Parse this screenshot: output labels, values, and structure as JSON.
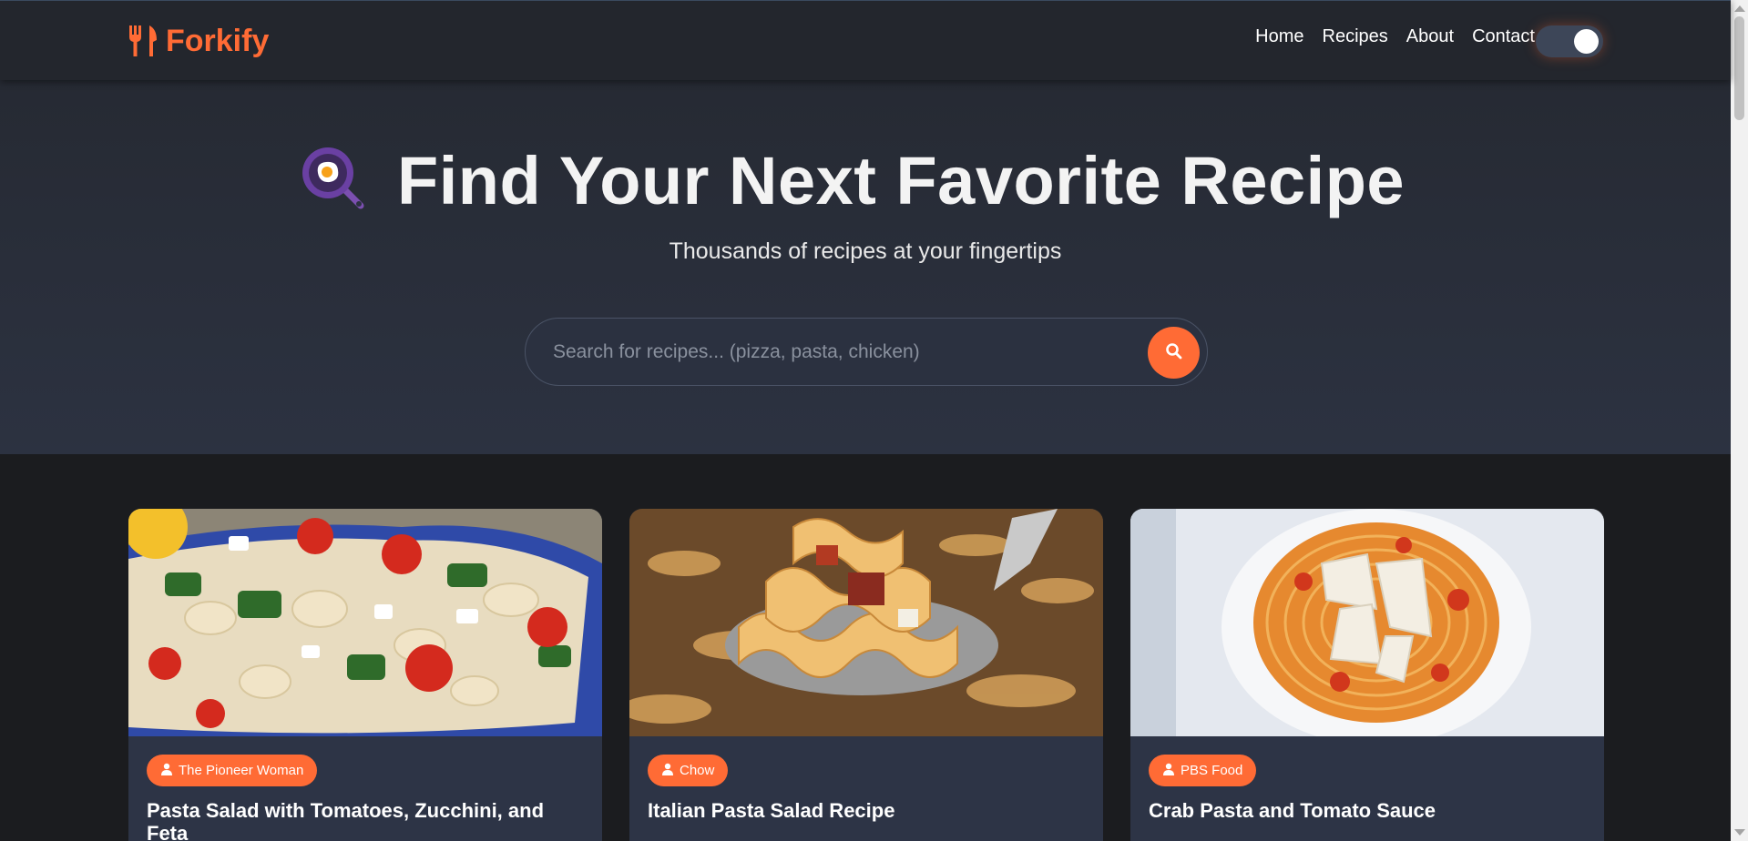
{
  "brand": {
    "name": "Forkify",
    "icon": "utensils-icon",
    "color": "#ff6b35"
  },
  "nav": {
    "items": [
      {
        "label": "Home"
      },
      {
        "label": "Recipes"
      },
      {
        "label": "About"
      },
      {
        "label": "Contact"
      }
    ],
    "theme_toggle": {
      "state": "on"
    }
  },
  "hero": {
    "icon": "frying-pan-icon",
    "title": "Find Your Next Favorite Recipe",
    "subtitle": "Thousands of recipes at your fingertips",
    "search": {
      "placeholder": "Search for recipes... (pizza, pasta, chicken)",
      "value": "",
      "button_icon": "search-icon"
    }
  },
  "recipes": [
    {
      "publisher": "The Pioneer Woman",
      "title": "Pasta Salad with Tomatoes, Zucchini, and Feta",
      "image": "pasta-salad-photo"
    },
    {
      "publisher": "Chow",
      "title": "Italian Pasta Salad Recipe",
      "image": "fusilli-spoon-photo"
    },
    {
      "publisher": "PBS Food",
      "title": "Crab Pasta and Tomato Sauce",
      "image": "spaghetti-parmesan-photo"
    }
  ],
  "colors": {
    "accent": "#ff6b35",
    "header_bg": "#23262d",
    "hero_bg": "#2c3241",
    "card_bg": "#2d3446",
    "page_bg": "#1b1c1f"
  }
}
